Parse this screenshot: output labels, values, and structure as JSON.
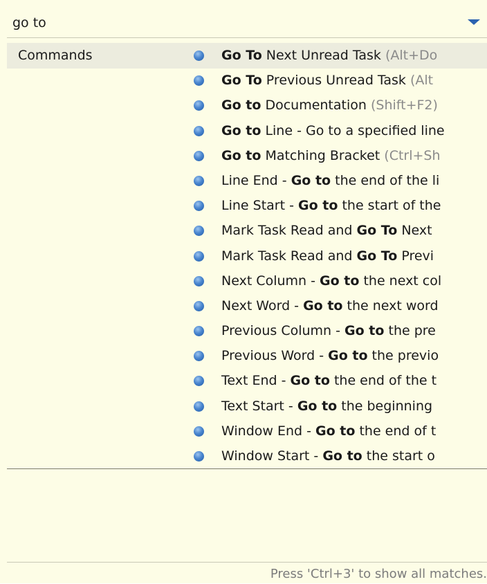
{
  "filter": {
    "value": "go to"
  },
  "category": {
    "label": "Commands"
  },
  "items": [
    {
      "before": "",
      "match": "Go To",
      "after": " Next Unread Task ",
      "shortcut": "(Alt+Do"
    },
    {
      "before": "",
      "match": "Go To",
      "after": " Previous Unread Task ",
      "shortcut": "(Alt"
    },
    {
      "before": "",
      "match": "Go to",
      "after": " Documentation ",
      "shortcut": "(Shift+F2)"
    },
    {
      "before": "",
      "match": "Go to",
      "after": " Line - Go to a specified line",
      "shortcut": ""
    },
    {
      "before": "",
      "match": "Go to",
      "after": " Matching Bracket ",
      "shortcut": "(Ctrl+Sh"
    },
    {
      "before": "Line End - ",
      "match": "Go to",
      "after": " the end of the li",
      "shortcut": ""
    },
    {
      "before": "Line Start - ",
      "match": "Go to",
      "after": " the start of the",
      "shortcut": ""
    },
    {
      "before": "Mark Task Read and ",
      "match": "Go To",
      "after": " Next",
      "shortcut": ""
    },
    {
      "before": "Mark Task Read and ",
      "match": "Go To",
      "after": " Previ",
      "shortcut": ""
    },
    {
      "before": "Next Column - ",
      "match": "Go to",
      "after": " the next col",
      "shortcut": ""
    },
    {
      "before": "Next Word - ",
      "match": "Go to",
      "after": " the next word",
      "shortcut": ""
    },
    {
      "before": "Previous Column - ",
      "match": "Go to",
      "after": " the pre",
      "shortcut": ""
    },
    {
      "before": "Previous Word - ",
      "match": "Go to",
      "after": " the previo",
      "shortcut": ""
    },
    {
      "before": "Text End - ",
      "match": "Go to",
      "after": " the end of the t",
      "shortcut": ""
    },
    {
      "before": "Text Start - ",
      "match": "Go to",
      "after": " the beginning",
      "shortcut": ""
    },
    {
      "before": "Window End - ",
      "match": "Go to",
      "after": " the end of t",
      "shortcut": ""
    },
    {
      "before": "Window Start - ",
      "match": "Go to",
      "after": " the start o",
      "shortcut": ""
    }
  ],
  "footer": {
    "hint": "Press 'Ctrl+3' to show all matches."
  },
  "icons": {
    "dropdown": "chevron-down-icon",
    "item_bullet": "command-bullet-icon"
  },
  "colors": {
    "popup_background": "#fdfde6",
    "category_band": "#ececde",
    "bullet_blue": "#2e6fc0",
    "dropdown_arrow": "#2c63b0",
    "shortcut_gray": "#8a8a8a"
  }
}
